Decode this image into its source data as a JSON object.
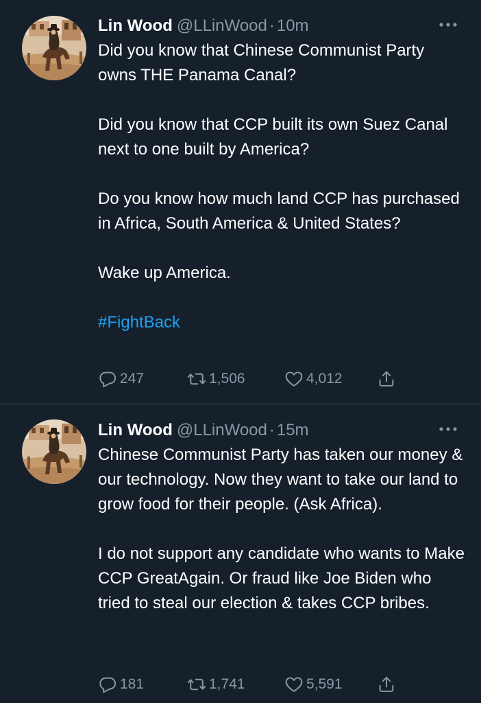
{
  "tweets": [
    {
      "author_name": "Lin Wood",
      "handle": "@LLinWood",
      "separator": "·",
      "time": "10m",
      "paragraphs": [
        "Did you know that Chinese Communist Party owns THE Panama Canal?",
        "Did you know that CCP built its own Suez Canal next to one built by America?",
        "Do you know how much land CCP has purchased in Africa, South America & United States?",
        "Wake up America."
      ],
      "hashtag": "#FightBack",
      "replies": "247",
      "retweets": "1,506",
      "likes": "4,012"
    },
    {
      "author_name": "Lin Wood",
      "handle": "@LLinWood",
      "separator": "·",
      "time": "15m",
      "paragraphs": [
        "Chinese Communist Party has taken our money & our technology. Now they want to take our land to grow food for their people. (Ask Africa).",
        "I do not support any candidate who wants to Make CCP GreatAgain. Or fraud like Joe Biden who tried to steal our election & takes CCP bribes."
      ],
      "replies": "181",
      "retweets": "1,741",
      "likes": "5,591"
    }
  ],
  "colors": {
    "background": "#15202b",
    "text_primary": "#ffffff",
    "text_secondary": "#8899a6",
    "link": "#1da1f2",
    "divider": "#38444d"
  },
  "icons": [
    "more-options-icon",
    "reply-icon",
    "retweet-icon",
    "like-icon",
    "share-icon"
  ]
}
